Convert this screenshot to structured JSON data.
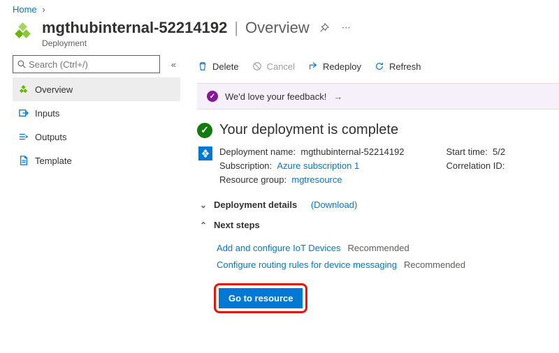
{
  "breadcrumb": {
    "home": "Home"
  },
  "header": {
    "name": "mgthubinternal-52214192",
    "section": "Overview",
    "subtype": "Deployment"
  },
  "sidebar": {
    "search_placeholder": "Search (Ctrl+/)",
    "items": [
      {
        "label": "Overview"
      },
      {
        "label": "Inputs"
      },
      {
        "label": "Outputs"
      },
      {
        "label": "Template"
      }
    ]
  },
  "toolbar": {
    "delete": "Delete",
    "cancel": "Cancel",
    "redeploy": "Redeploy",
    "refresh": "Refresh"
  },
  "feedback": {
    "text": "We'd love your feedback!"
  },
  "status": {
    "title": "Your deployment is complete"
  },
  "details": {
    "left": {
      "deployment_label": "Deployment name:",
      "deployment_value": "mgthubinternal-52214192",
      "subscription_label": "Subscription:",
      "subscription_value": "Azure subscription 1",
      "rg_label": "Resource group:",
      "rg_value": "mgtresource"
    },
    "right": {
      "start_label": "Start time:",
      "start_value": "5/2",
      "corr_label": "Correlation ID:"
    }
  },
  "sections": {
    "deployment_details": "Deployment details",
    "download": "(Download)",
    "next_steps": "Next steps"
  },
  "next": {
    "item1": "Add and configure IoT Devices",
    "item2": "Configure routing rules for device messaging",
    "rec": "Recommended"
  },
  "go_button": "Go to resource"
}
